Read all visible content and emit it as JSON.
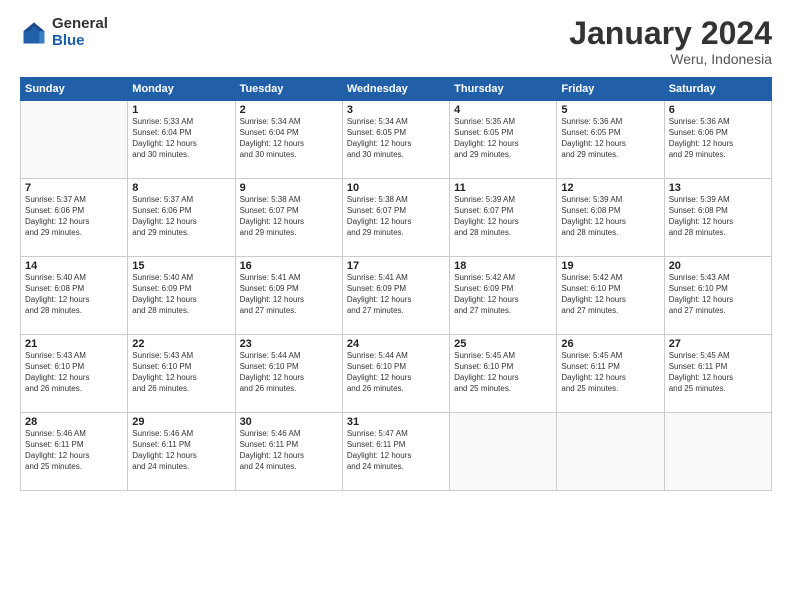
{
  "logo": {
    "general": "General",
    "blue": "Blue"
  },
  "title": "January 2024",
  "subtitle": "Weru, Indonesia",
  "headers": [
    "Sunday",
    "Monday",
    "Tuesday",
    "Wednesday",
    "Thursday",
    "Friday",
    "Saturday"
  ],
  "weeks": [
    [
      {
        "day": "",
        "info": ""
      },
      {
        "day": "1",
        "info": "Sunrise: 5:33 AM\nSunset: 6:04 PM\nDaylight: 12 hours\nand 30 minutes."
      },
      {
        "day": "2",
        "info": "Sunrise: 5:34 AM\nSunset: 6:04 PM\nDaylight: 12 hours\nand 30 minutes."
      },
      {
        "day": "3",
        "info": "Sunrise: 5:34 AM\nSunset: 6:05 PM\nDaylight: 12 hours\nand 30 minutes."
      },
      {
        "day": "4",
        "info": "Sunrise: 5:35 AM\nSunset: 6:05 PM\nDaylight: 12 hours\nand 29 minutes."
      },
      {
        "day": "5",
        "info": "Sunrise: 5:36 AM\nSunset: 6:05 PM\nDaylight: 12 hours\nand 29 minutes."
      },
      {
        "day": "6",
        "info": "Sunrise: 5:36 AM\nSunset: 6:06 PM\nDaylight: 12 hours\nand 29 minutes."
      }
    ],
    [
      {
        "day": "7",
        "info": "Sunrise: 5:37 AM\nSunset: 6:06 PM\nDaylight: 12 hours\nand 29 minutes."
      },
      {
        "day": "8",
        "info": "Sunrise: 5:37 AM\nSunset: 6:06 PM\nDaylight: 12 hours\nand 29 minutes."
      },
      {
        "day": "9",
        "info": "Sunrise: 5:38 AM\nSunset: 6:07 PM\nDaylight: 12 hours\nand 29 minutes."
      },
      {
        "day": "10",
        "info": "Sunrise: 5:38 AM\nSunset: 6:07 PM\nDaylight: 12 hours\nand 29 minutes."
      },
      {
        "day": "11",
        "info": "Sunrise: 5:39 AM\nSunset: 6:07 PM\nDaylight: 12 hours\nand 28 minutes."
      },
      {
        "day": "12",
        "info": "Sunrise: 5:39 AM\nSunset: 6:08 PM\nDaylight: 12 hours\nand 28 minutes."
      },
      {
        "day": "13",
        "info": "Sunrise: 5:39 AM\nSunset: 6:08 PM\nDaylight: 12 hours\nand 28 minutes."
      }
    ],
    [
      {
        "day": "14",
        "info": "Sunrise: 5:40 AM\nSunset: 6:08 PM\nDaylight: 12 hours\nand 28 minutes."
      },
      {
        "day": "15",
        "info": "Sunrise: 5:40 AM\nSunset: 6:09 PM\nDaylight: 12 hours\nand 28 minutes."
      },
      {
        "day": "16",
        "info": "Sunrise: 5:41 AM\nSunset: 6:09 PM\nDaylight: 12 hours\nand 27 minutes."
      },
      {
        "day": "17",
        "info": "Sunrise: 5:41 AM\nSunset: 6:09 PM\nDaylight: 12 hours\nand 27 minutes."
      },
      {
        "day": "18",
        "info": "Sunrise: 5:42 AM\nSunset: 6:09 PM\nDaylight: 12 hours\nand 27 minutes."
      },
      {
        "day": "19",
        "info": "Sunrise: 5:42 AM\nSunset: 6:10 PM\nDaylight: 12 hours\nand 27 minutes."
      },
      {
        "day": "20",
        "info": "Sunrise: 5:43 AM\nSunset: 6:10 PM\nDaylight: 12 hours\nand 27 minutes."
      }
    ],
    [
      {
        "day": "21",
        "info": "Sunrise: 5:43 AM\nSunset: 6:10 PM\nDaylight: 12 hours\nand 26 minutes."
      },
      {
        "day": "22",
        "info": "Sunrise: 5:43 AM\nSunset: 6:10 PM\nDaylight: 12 hours\nand 26 minutes."
      },
      {
        "day": "23",
        "info": "Sunrise: 5:44 AM\nSunset: 6:10 PM\nDaylight: 12 hours\nand 26 minutes."
      },
      {
        "day": "24",
        "info": "Sunrise: 5:44 AM\nSunset: 6:10 PM\nDaylight: 12 hours\nand 26 minutes."
      },
      {
        "day": "25",
        "info": "Sunrise: 5:45 AM\nSunset: 6:10 PM\nDaylight: 12 hours\nand 25 minutes."
      },
      {
        "day": "26",
        "info": "Sunrise: 5:45 AM\nSunset: 6:11 PM\nDaylight: 12 hours\nand 25 minutes."
      },
      {
        "day": "27",
        "info": "Sunrise: 5:45 AM\nSunset: 6:11 PM\nDaylight: 12 hours\nand 25 minutes."
      }
    ],
    [
      {
        "day": "28",
        "info": "Sunrise: 5:46 AM\nSunset: 6:11 PM\nDaylight: 12 hours\nand 25 minutes."
      },
      {
        "day": "29",
        "info": "Sunrise: 5:46 AM\nSunset: 6:11 PM\nDaylight: 12 hours\nand 24 minutes."
      },
      {
        "day": "30",
        "info": "Sunrise: 5:46 AM\nSunset: 6:11 PM\nDaylight: 12 hours\nand 24 minutes."
      },
      {
        "day": "31",
        "info": "Sunrise: 5:47 AM\nSunset: 6:11 PM\nDaylight: 12 hours\nand 24 minutes."
      },
      {
        "day": "",
        "info": ""
      },
      {
        "day": "",
        "info": ""
      },
      {
        "day": "",
        "info": ""
      }
    ]
  ]
}
